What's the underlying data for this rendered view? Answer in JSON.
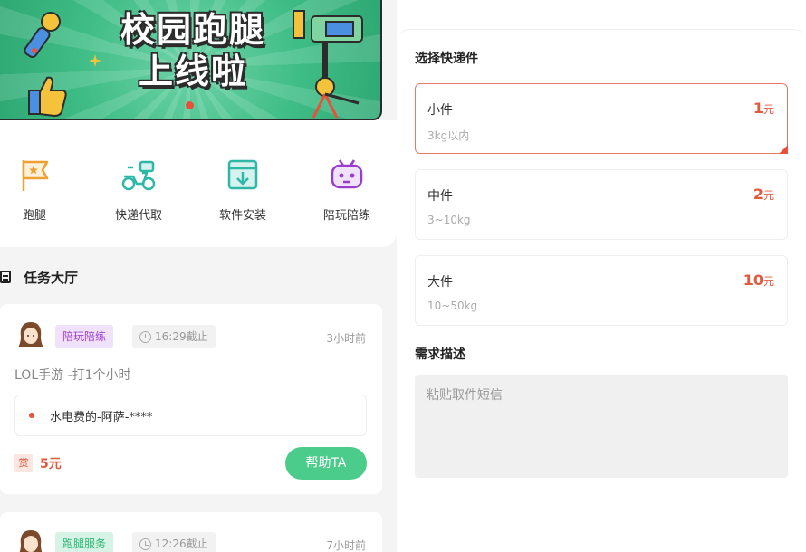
{
  "banner": {
    "title_line1": "校园跑腿",
    "title_line2": "上线啦"
  },
  "quick_actions": [
    {
      "label": "跑腿",
      "icon": "flag-icon",
      "color": "#f0a030"
    },
    {
      "label": "快递代取",
      "icon": "scooter-icon",
      "color": "#2eb8a8"
    },
    {
      "label": "软件安装",
      "icon": "download-box-icon",
      "color": "#2eb8a8"
    },
    {
      "label": "陪玩陪练",
      "icon": "gamepad-icon",
      "color": "#9b3ccc"
    }
  ],
  "task_hall": {
    "title": "任务大厅",
    "tasks": [
      {
        "tag": "陪玩陪练",
        "deadline": "16:29截止",
        "ago": "3小时前",
        "desc": "LOL手游 -打1个小时",
        "address": "水电费的-阿萨-****",
        "reward_badge": "赏",
        "reward": "5元",
        "help_label": "帮助TA"
      },
      {
        "tag": "跑腿服务",
        "deadline": "12:26截止",
        "ago": "7小时前"
      }
    ]
  },
  "form": {
    "size_title": "选择快递件",
    "sizes": [
      {
        "name": "小件",
        "range": "3kg以内",
        "price": "1",
        "unit": "元",
        "selected": true
      },
      {
        "name": "中件",
        "range": "3~10kg",
        "price": "2",
        "unit": "元",
        "selected": false
      },
      {
        "name": "大件",
        "range": "10~50kg",
        "price": "10",
        "unit": "元",
        "selected": false
      }
    ],
    "desc_title": "需求描述",
    "desc_placeholder": "粘贴取件短信"
  },
  "colors": {
    "accent_green": "#4ccc8a",
    "price_red": "#e05a40"
  }
}
